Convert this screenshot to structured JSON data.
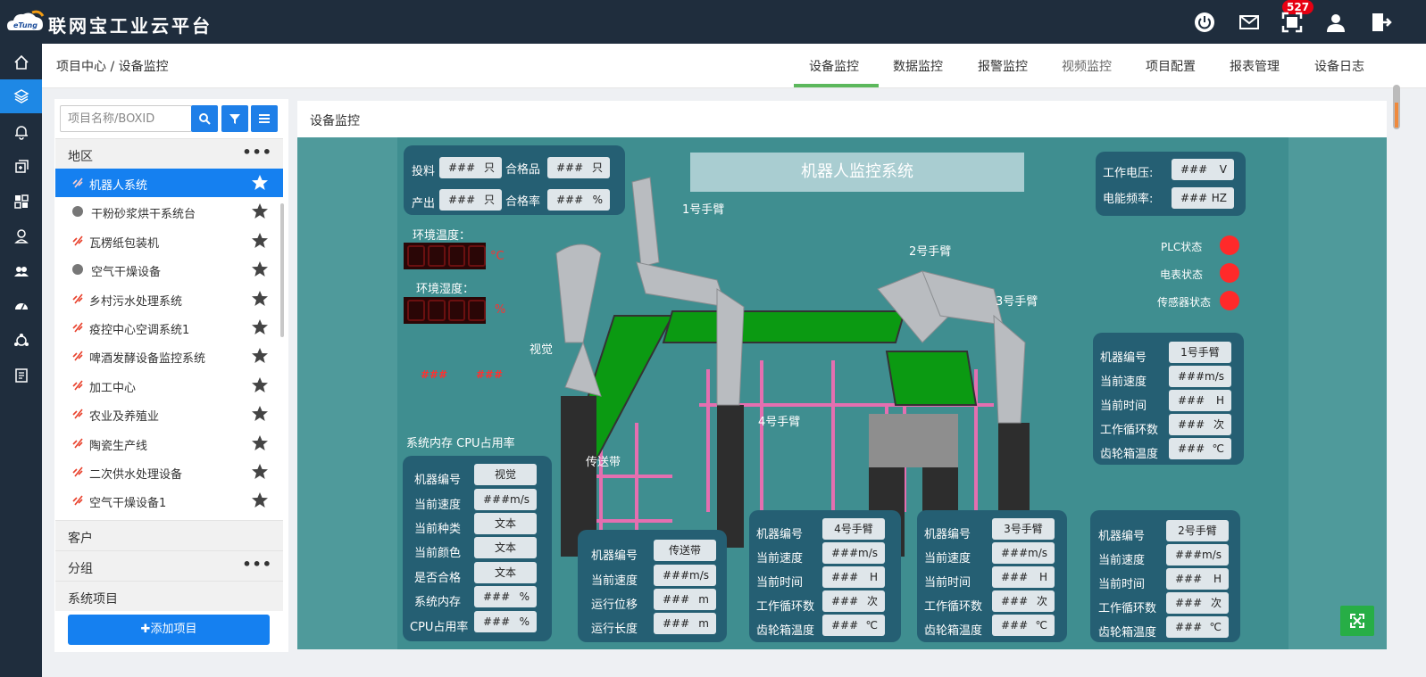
{
  "topbar": {
    "logo_text": "eTung",
    "title": "联网宝工业云平台",
    "badge": "527"
  },
  "header": {
    "breadcrumb": "项目中心 / 设备监控",
    "tabs": [
      {
        "label": "设备监控"
      },
      {
        "label": "数据监控"
      },
      {
        "label": "报警监控"
      },
      {
        "label": "视频监控"
      },
      {
        "label": "项目配置"
      },
      {
        "label": "报表管理"
      },
      {
        "label": "设备日志"
      }
    ]
  },
  "sidebar": {
    "search_placeholder": "项目名称/BOXID",
    "section_region": "地区",
    "items": [
      {
        "label": "机器人系统"
      },
      {
        "label": "干粉砂浆烘干系统台"
      },
      {
        "label": "瓦楞纸包装机"
      },
      {
        "label": "空气干燥设备"
      },
      {
        "label": "乡村污水处理系统"
      },
      {
        "label": "疫控中心空调系统1"
      },
      {
        "label": "啤酒发酵设备监控系统"
      },
      {
        "label": "加工中心"
      },
      {
        "label": "农业及养殖业"
      },
      {
        "label": "陶瓷生产线"
      },
      {
        "label": "二次供水处理设备"
      },
      {
        "label": "空气干燥设备1"
      }
    ],
    "section_customer": "客户",
    "section_group": "分组",
    "section_system": "系统项目",
    "add_button": "✚添加项目"
  },
  "main": {
    "title": "设备监控",
    "scene": {
      "system_title": "机器人监控系统",
      "production": {
        "feed_label": "投料",
        "feed_value": "###",
        "feed_unit": "只",
        "qualified_label": "合格品",
        "qualified_value": "###",
        "qualified_unit": "只",
        "output_label": "产出",
        "output_value": "###",
        "output_unit": "只",
        "rate_label": "合格率",
        "rate_value": "###",
        "rate_unit": "%"
      },
      "env_temp_label": "环境温度：",
      "temp_unit": "°C",
      "env_humid_label": "环境湿度：",
      "humid_unit": "%",
      "red_values": [
        "###",
        "###"
      ],
      "mem_cpu_label": "系统内存  CPU占用率",
      "power": {
        "voltage_label": "工作电压:",
        "voltage_value": "###",
        "voltage_unit": "V",
        "freq_label": "电能频率:",
        "freq_value": "###",
        "freq_unit": "HZ"
      },
      "status": {
        "plc": "PLC状态",
        "meter": "电表状态",
        "sensor": "传感器状态"
      },
      "scene_labels": {
        "arm1": "1号手臂",
        "arm2": "2号手臂",
        "arm3": "3号手臂",
        "arm4": "4号手臂",
        "vision": "视觉",
        "conveyor": "传送带"
      },
      "vision_panel": {
        "id_label": "机器编号",
        "id_value": "视觉",
        "speed_label": "当前速度",
        "speed_value": "###",
        "speed_unit": "m/s",
        "kind_label": "当前种类",
        "kind_value": "文本",
        "color_label": "当前颜色",
        "color_value": "文本",
        "pass_label": "是否合格",
        "pass_value": "文本",
        "mem_label": "系统内存",
        "mem_value": "###",
        "mem_unit": "%",
        "cpu_label": "CPU占用率",
        "cpu_value": "###",
        "cpu_unit": "%"
      },
      "conveyor_panel": {
        "id_label": "机器编号",
        "id_value": "传送带",
        "speed_label": "当前速度",
        "speed_value": "###",
        "speed_unit": "m/s",
        "disp_label": "运行位移",
        "disp_value": "###",
        "disp_unit": "m",
        "len_label": "运行长度",
        "len_value": "###",
        "len_unit": "m"
      },
      "arm_panels": [
        {
          "id_label": "机器编号",
          "id_value": "1号手臂",
          "speed_label": "当前速度",
          "speed_value": "###",
          "speed_unit": "m/s",
          "time_label": "当前时间",
          "time_value": "###",
          "time_unit": "H",
          "cycle_label": "工作循环数",
          "cycle_value": "###",
          "cycle_unit": "次",
          "gear_label": "齿轮箱温度",
          "gear_value": "###",
          "gear_unit": "℃"
        },
        {
          "id_label": "机器编号",
          "id_value": "4号手臂",
          "speed_label": "当前速度",
          "speed_value": "###",
          "speed_unit": "m/s",
          "time_label": "当前时间",
          "time_value": "###",
          "time_unit": "H",
          "cycle_label": "工作循环数",
          "cycle_value": "###",
          "cycle_unit": "次",
          "gear_label": "齿轮箱温度",
          "gear_value": "###",
          "gear_unit": "℃"
        },
        {
          "id_label": "机器编号",
          "id_value": "3号手臂",
          "speed_label": "当前速度",
          "speed_value": "###",
          "speed_unit": "m/s",
          "time_label": "当前时间",
          "time_value": "###",
          "time_unit": "H",
          "cycle_label": "工作循环数",
          "cycle_value": "###",
          "cycle_unit": "次",
          "gear_label": "齿轮箱温度",
          "gear_value": "###",
          "gear_unit": "℃"
        },
        {
          "id_label": "机器编号",
          "id_value": "2号手臂",
          "speed_label": "当前速度",
          "speed_value": "###",
          "speed_unit": "m/s",
          "time_label": "当前时间",
          "time_value": "###",
          "time_unit": "H",
          "cycle_label": "工作循环数",
          "cycle_value": "###",
          "cycle_unit": "次",
          "gear_label": "齿轮箱温度",
          "gear_value": "###",
          "gear_unit": "℃"
        }
      ]
    }
  },
  "colors": {
    "topbar": "#1f2d3d",
    "accent": "#1580f0",
    "tab_active_underline": "#5cb85c",
    "status_red": "#ff2a2a",
    "badge_red": "#e60012"
  },
  "icons": [
    "home-icon",
    "layers-icon",
    "bell-icon",
    "plus-square-icon",
    "dashboard-icon",
    "user-pin-icon",
    "users-icon",
    "gauge-icon",
    "network-icon",
    "document-icon",
    "power-icon",
    "mail-icon",
    "fullscreen-icon",
    "user-icon",
    "logout-icon",
    "search-icon",
    "filter-icon",
    "menu-icon",
    "star-icon",
    "link-broken-icon",
    "expand-icon"
  ]
}
